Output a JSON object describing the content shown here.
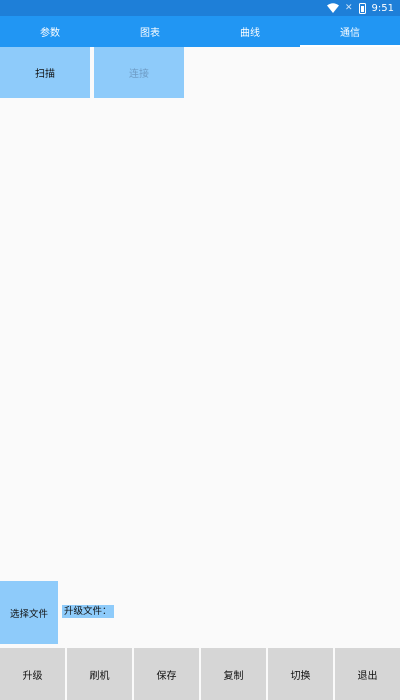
{
  "status_bar": {
    "time": "9:51",
    "icons": [
      "wifi-icon",
      "no-sim-icon",
      "battery-icon"
    ]
  },
  "tabs": [
    {
      "label": "参数",
      "active": false
    },
    {
      "label": "图表",
      "active": false
    },
    {
      "label": "曲线",
      "active": false
    },
    {
      "label": "通信",
      "active": true
    }
  ],
  "actions": {
    "scan_label": "扫描",
    "connect_label": "连接"
  },
  "file": {
    "select_file_label": "选择文件",
    "upgrade_file_label": "升级文件："
  },
  "bottom_buttons": [
    {
      "label": "升级"
    },
    {
      "label": "刷机"
    },
    {
      "label": "保存"
    },
    {
      "label": "复制"
    },
    {
      "label": "切换"
    },
    {
      "label": "退出"
    }
  ],
  "colors": {
    "status_bar": "#1e7fd8",
    "tab_bar": "#2196f3",
    "accent_button": "#8ecbfa",
    "bottom_button": "#d6d6d6",
    "background": "#fafafa"
  }
}
